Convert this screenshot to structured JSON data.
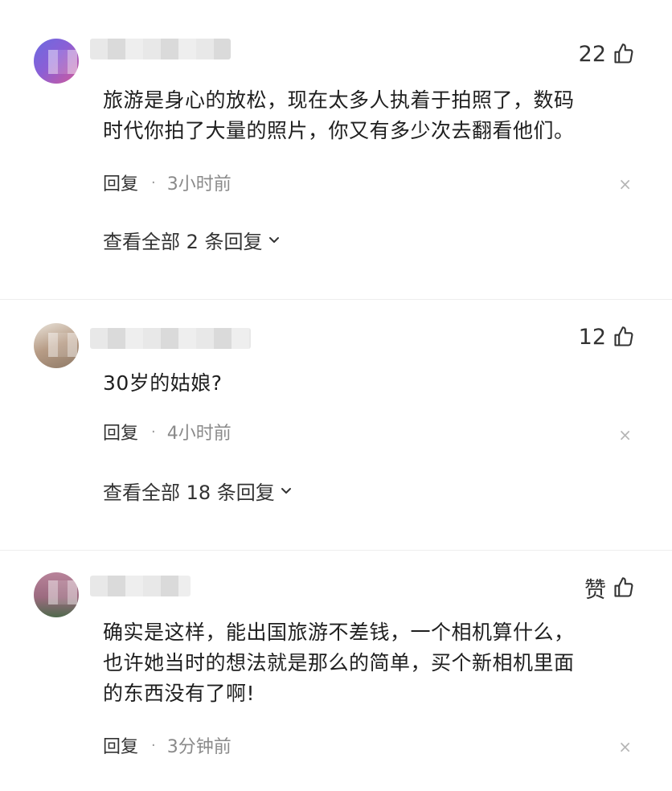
{
  "comments": [
    {
      "likes": "22",
      "text_lines": [
        "旅游是身心的放松，现在太多人执着于拍照了，数码",
        "时代你拍了大量的照片，你又有多少次去翻看他们。"
      ],
      "reply_label": "回复",
      "separator": "·",
      "time": "3小时前",
      "close": "×",
      "view_all": "查看全部 2 条回复"
    },
    {
      "likes": "12",
      "text_lines": [
        "30岁的姑娘?"
      ],
      "reply_label": "回复",
      "separator": "·",
      "time": "4小时前",
      "close": "×",
      "view_all": "查看全部 18 条回复"
    },
    {
      "likes": "赞",
      "text_lines": [
        "确实是这样，能出国旅游不差钱，一个相机算什么，",
        "也许她当时的想法就是那么的简单，买个新相机里面",
        "的东西没有了啊!"
      ],
      "reply_label": "回复",
      "separator": "·",
      "time": "3分钟前",
      "close": "×"
    }
  ],
  "icons": {
    "like": "thumb-up-icon",
    "chevron": "chevron-down-icon",
    "close": "close-icon"
  },
  "colors": {
    "text": "#1f1f1f",
    "meta_time": "#8a8a8a",
    "close": "#b5b5b5"
  }
}
